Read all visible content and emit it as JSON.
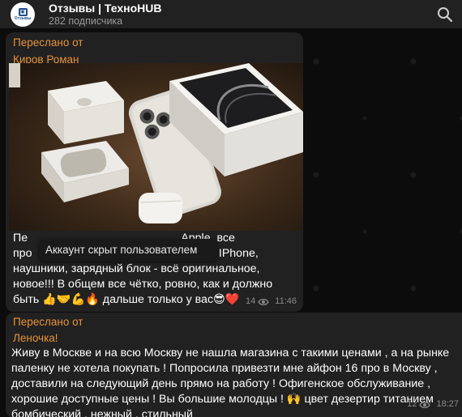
{
  "header": {
    "title": "Отзывы | ТехноHUB",
    "subscribers": "282 подписчика",
    "avatar_text": "Отзывы",
    "avatar_sub": "ТЕХНО"
  },
  "messages": [
    {
      "forwarded_label": "Переслано от",
      "forwarded_name": "Киров Роман",
      "body_line1_a": "Пе",
      "body_line1_b": "Apple, все",
      "body_line2_a": "про",
      "body_line2_b": "стро, IPhone,",
      "body_line3": "наушники, зарядный блок - всё оригинальное,",
      "body_line4": "новое!!! В общем все чётко, ровно, как и должно",
      "body_line5_a": "быть",
      "body_line5_emoji": "👍🤝💪🔥",
      "body_line5_b": "дальше только у вас",
      "body_line5_emoji2": "😎❤️",
      "views": "14",
      "time": "11:46",
      "tooltip": "Аккаунт скрыт пользователем"
    },
    {
      "forwarded_label": "Переслано от",
      "forwarded_name": "Леночка!",
      "body": "Живу в Москве и на всю Москву не нашла магазина с такими ценами , а на рынке паленку не хотела покупать ! Попросила привезти мне айфон 16 про в Москву , доставили на следующий день прямо на работу ! Офигенское обслуживание , хорошие доступные цены ! Вы большие молодцы ! 🙌 цвет дезертир титанием бомбический , нежный , стильный",
      "views": "12",
      "time": "18:27"
    }
  ],
  "colors": {
    "accent": "#e8923a",
    "bubble": "#212121",
    "header": "#212121"
  },
  "icons": {
    "search": "search-icon",
    "views": "eye-icon"
  }
}
